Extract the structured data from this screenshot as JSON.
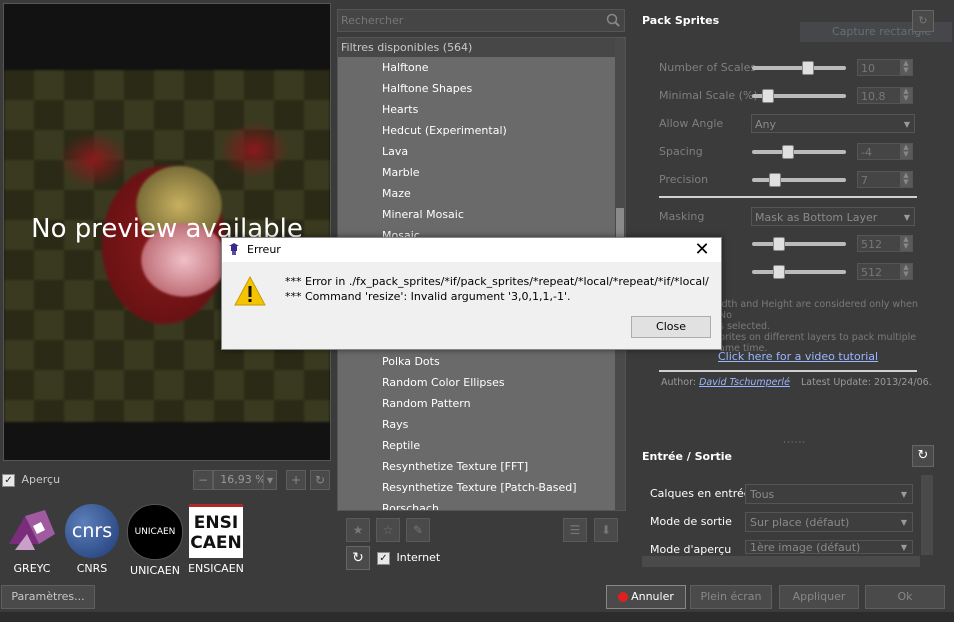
{
  "preview": {
    "no_preview": "No preview available",
    "apercu_label": "Aperçu",
    "apercu_checked": true,
    "zoom_value": "16,93 %"
  },
  "logos": [
    {
      "name": "GREYC"
    },
    {
      "name": "CNRS",
      "mark": "cnrs"
    },
    {
      "name": "UNICAEN",
      "mark": "UNICAEN"
    },
    {
      "name": "ENSICAEN",
      "mark_top": "ENSI",
      "mark_bottom": "CAEN"
    }
  ],
  "filters": {
    "search_placeholder": "Rechercher",
    "header": "Filtres disponibles (564)",
    "items": [
      "Halftone",
      "Halftone Shapes",
      "Hearts",
      "Hedcut (Experimental)",
      "Lava",
      "Marble",
      "Maze",
      "Mineral Mosaic",
      "Mosaic",
      "",
      "",
      "",
      "",
      "",
      "Polka Dots",
      "Random Color Ellipses",
      "Random Pattern",
      "Rays",
      "Reptile",
      "Resynthetize Texture [FFT]",
      "Resynthetize Texture [Patch-Based]",
      "Rorschach"
    ],
    "internet_label": "Internet",
    "internet_checked": true
  },
  "pack": {
    "title": "Pack Sprites",
    "capture_label": "Capture rectangle",
    "params": [
      {
        "label": "Number of Scales",
        "value": "10",
        "level": 0.6
      },
      {
        "label": "Minimal Scale (%)",
        "value": "10.8",
        "level": 0.12
      },
      {
        "label": "Allow Angle",
        "combo": "Any"
      },
      {
        "label": "Spacing",
        "value": "-4",
        "level": 0.36
      },
      {
        "label": "Precision",
        "value": "7",
        "level": 0.2
      },
      {
        "label": "Masking",
        "combo": "Mask as Bottom Layer"
      },
      {
        "label": "",
        "value": "512",
        "level": 0.25
      },
      {
        "label": "",
        "value": "512",
        "level": 0.25
      }
    ],
    "note_line1": "idth and Height are considered only when No",
    "note_line2": "s selected.",
    "note_line3": "prites on different layers to pack multiple",
    "note_line4": "ame time.",
    "video_link": "Click here for a video tutorial",
    "author_prefix": "Author:",
    "author_name": "David Tschumperlé",
    "update": "Latest Update: 2013/24/06."
  },
  "io": {
    "title": "Entrée / Sortie",
    "rows": [
      {
        "label": "Calques en entrée",
        "value": "Tous"
      },
      {
        "label": "Mode de sortie",
        "value": "Sur place (défaut)"
      },
      {
        "label": "Mode d'aperçu",
        "value": "1ère image (défaut)"
      }
    ]
  },
  "bottom": {
    "params_button": "Paramètres...",
    "cancel": "Annuler",
    "fullscreen": "Plein écran",
    "apply": "Appliquer",
    "ok": "Ok"
  },
  "dialog": {
    "title": "Erreur",
    "line1": "*** Error in ./fx_pack_sprites/*if/pack_sprites/*repeat/*local/*repeat/*if/*local/",
    "line2": "*** Command 'resize': Invalid argument '3,0,1,1,-1'.",
    "close_button": "Close",
    "close_glyph": "✕"
  },
  "colors": {
    "accent_link": "#9ab8ff",
    "warning": "#f5c400",
    "cancel_dot": "#e02020"
  }
}
